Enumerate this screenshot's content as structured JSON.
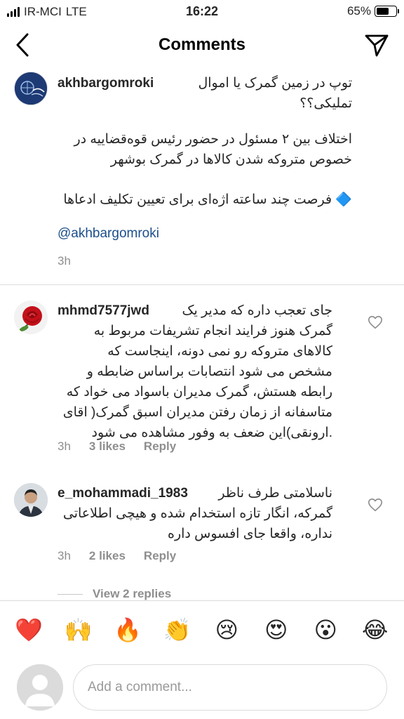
{
  "status_bar": {
    "carrier": "IR-MCI",
    "network": "LTE",
    "time": "16:22",
    "battery_text": "65%",
    "battery_level": 0.65
  },
  "header": {
    "title": "Comments"
  },
  "caption": {
    "username": "akhbargomroki",
    "line1": "توپ در زمین گمرک یا اموال",
    "line2": "تملیکی؟؟",
    "para2_line1": "اختلاف بین ۲ مسئول در حضور رئیس قوه‌قضاییه در",
    "para2_line2": "خصوص متروکه شدن کالاها در گمرک بوشهر",
    "para3": "🔷 فرصت چند ساعته اژه‌ای برای تعیین تکلیف ادعاها",
    "mention": "@akhbargomroki",
    "time": "3h"
  },
  "comments": [
    {
      "username": "mhmd7577jwd",
      "lines": [
        "جای تعجب داره که مدیر یک",
        "گمرک هنوز فرایند انجام  تشریفات مربوط به",
        "کالاهای متروکه رو نمی دونه، اینجاست که",
        "مشخص می شود انتصابات براساس ضابطه و",
        "رابطه هستش، گمرک مدیران باسواد می خواد که",
        "متاسفانه از زمان رفتن مدیران  اسبق گمرک( اقای",
        ".ارونقی)این ضعف به وفور مشاهده می شود"
      ],
      "time": "3h",
      "likes": "3 likes",
      "reply": "Reply"
    },
    {
      "username": "e_mohammadi_1983",
      "lines": [
        "ناسلامتی طرف ناظر",
        "گمرکه، انگار تازه استخدام شده و هیچی اطلاعاتی",
        "نداره، واقعا جای افسوس داره"
      ],
      "time": "3h",
      "likes": "2 likes",
      "reply": "Reply"
    }
  ],
  "view_replies": "View 2 replies",
  "emojis": [
    "❤️",
    "🙌",
    "🔥",
    "👏",
    "😢",
    "😍",
    "😮",
    "😂"
  ],
  "input": {
    "placeholder": "Add a comment..."
  }
}
